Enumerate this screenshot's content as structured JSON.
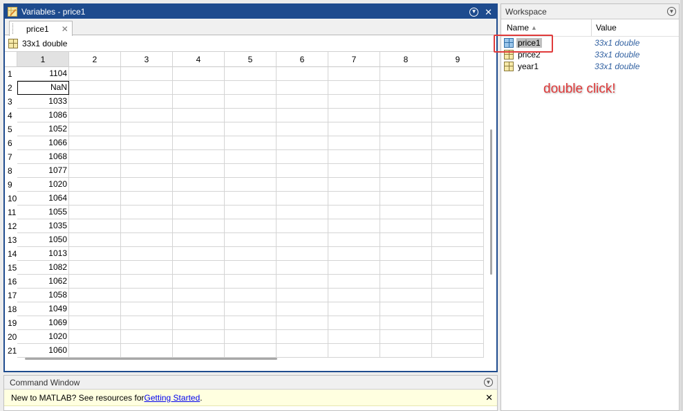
{
  "variables_panel": {
    "title": "Variables - price1",
    "tab_label": "price1",
    "info_label": "33x1 double",
    "column_headers": [
      "1",
      "2",
      "3",
      "4",
      "5",
      "6",
      "7",
      "8",
      "9"
    ],
    "active_column": "1",
    "selected_row": "2",
    "rows": [
      {
        "n": "1",
        "v": "1104"
      },
      {
        "n": "2",
        "v": "NaN"
      },
      {
        "n": "3",
        "v": "1033"
      },
      {
        "n": "4",
        "v": "1086"
      },
      {
        "n": "5",
        "v": "1052"
      },
      {
        "n": "6",
        "v": "1066"
      },
      {
        "n": "7",
        "v": "1068"
      },
      {
        "n": "8",
        "v": "1077"
      },
      {
        "n": "9",
        "v": "1020"
      },
      {
        "n": "10",
        "v": "1064"
      },
      {
        "n": "11",
        "v": "1055"
      },
      {
        "n": "12",
        "v": "1035"
      },
      {
        "n": "13",
        "v": "1050"
      },
      {
        "n": "14",
        "v": "1013"
      },
      {
        "n": "15",
        "v": "1082"
      },
      {
        "n": "16",
        "v": "1062"
      },
      {
        "n": "17",
        "v": "1058"
      },
      {
        "n": "18",
        "v": "1049"
      },
      {
        "n": "19",
        "v": "1069"
      },
      {
        "n": "20",
        "v": "1020"
      },
      {
        "n": "21",
        "v": "1060"
      }
    ]
  },
  "workspace": {
    "title": "Workspace",
    "name_header": "Name",
    "value_header": "Value",
    "sort_indicator": "▲",
    "variables": [
      {
        "name": "price1",
        "value": "33x1 double",
        "selected": true
      },
      {
        "name": "price2",
        "value": "33x1 double",
        "selected": false
      },
      {
        "name": "year1",
        "value": "33x1 double",
        "selected": false
      }
    ]
  },
  "annotation": {
    "text": "double click!",
    "color": "#e03a3a"
  },
  "command_window": {
    "title": "Command Window",
    "banner_text": "New to MATLAB? See resources for ",
    "banner_link": "Getting Started",
    "banner_suffix": "."
  },
  "icons": {
    "panel_menu": "chevron-circle-icon",
    "close": "close-icon",
    "variable": "matrix-grid-icon"
  },
  "colors": {
    "active_title_bar": "#1e4b8e",
    "value_text": "#2f5fa0",
    "banner_background": "#ffffe0"
  }
}
